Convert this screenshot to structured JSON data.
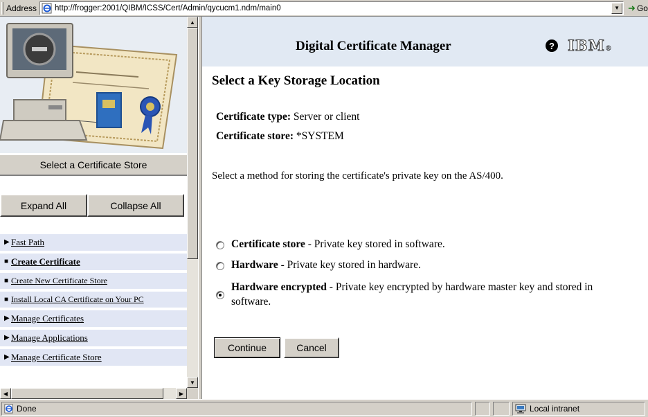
{
  "address_bar": {
    "label": "Address",
    "url": "http://frogger:2001/QIBM/ICSS/Cert/Admin/qycucm1.ndm/main0",
    "go_label": "Go"
  },
  "sidebar": {
    "select_store_label": "Select a Certificate Store",
    "expand_all": "Expand All",
    "collapse_all": "Collapse All",
    "items": [
      {
        "label": "Fast Path",
        "marker": "▶"
      },
      {
        "label": "Create Certificate",
        "marker": "■"
      },
      {
        "label": "Create New Certificate Store",
        "marker": "■"
      },
      {
        "label": "Install Local CA Certificate on Your PC",
        "marker": "■"
      },
      {
        "label": "Manage Certificates",
        "marker": "▶"
      },
      {
        "label": "Manage Applications",
        "marker": "▶"
      },
      {
        "label": "Manage Certificate Store",
        "marker": "▶"
      }
    ]
  },
  "header": {
    "title": "Digital Certificate Manager",
    "help_icon": "?",
    "brand": "IBM",
    "brand_mark": "®"
  },
  "main": {
    "heading": "Select a Key Storage Location",
    "cert_type_label": "Certificate type:",
    "cert_type_value": "Server or client",
    "cert_store_label": "Certificate store:",
    "cert_store_value": "*SYSTEM",
    "instruction": "Select a method for storing the certificate's private key on the AS/400.",
    "options": [
      {
        "name": "Certificate store",
        "desc": " - Private key stored in software.",
        "selected": false
      },
      {
        "name": "Hardware",
        "desc": " - Private key stored in hardware.",
        "selected": false
      },
      {
        "name": "Hardware encrypted",
        "desc": " - Private key encrypted by hardware master key and stored in software.",
        "selected": true
      }
    ],
    "continue_label": "Continue",
    "cancel_label": "Cancel"
  },
  "status_bar": {
    "status_text": "Done",
    "zone_text": "Local intranet"
  }
}
